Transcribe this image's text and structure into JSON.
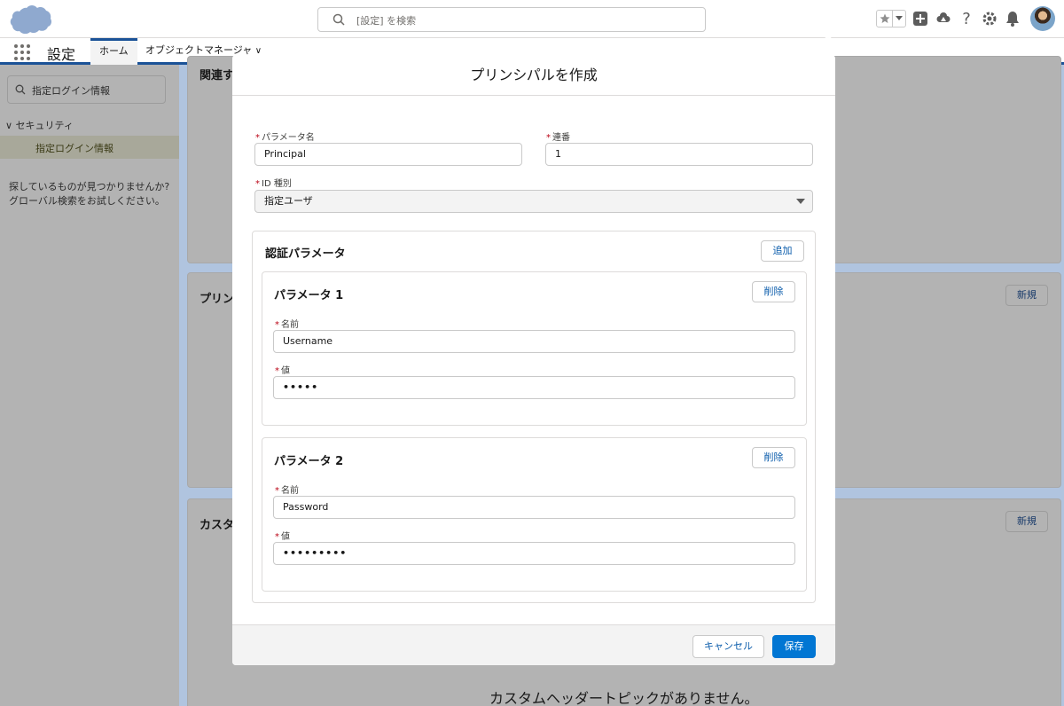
{
  "header": {
    "search_placeholder": "[設定] を検索"
  },
  "context_bar": {
    "app_name": "設定",
    "tabs": [
      {
        "label": "ホーム"
      },
      {
        "label": "オブジェクトマネージャ"
      }
    ]
  },
  "sidebar": {
    "search_value": "指定ログイン情報",
    "section": "セキュリティ",
    "selected_item": "指定ログイン情報",
    "hint": "探しているものが見つかりませんか? グローバル検索をお試しください。"
  },
  "background": {
    "card1_title": "関連す",
    "card2_title": "プリン",
    "card3_title": "カスタ",
    "new_button_label": "新規",
    "empty_message": "カスタムヘッダートピックがありません。"
  },
  "modal": {
    "title": "プリンシパルを作成",
    "param_name_label": "パラメータ名",
    "param_name_value": "Principal",
    "sequence_label": "連番",
    "sequence_value": "1",
    "id_type_label": "ID 種別",
    "id_type_value": "指定ユーザ",
    "auth_section_title": "認証パラメータ",
    "add_button": "追加",
    "parameters": [
      {
        "title": "パラメータ 1",
        "delete_label": "削除",
        "name_label": "名前",
        "name_value": "Username",
        "value_label": "値",
        "value_masked": "•••••"
      },
      {
        "title": "パラメータ 2",
        "delete_label": "削除",
        "name_label": "名前",
        "name_value": "Password",
        "value_label": "値",
        "value_masked": "•••••••••"
      }
    ],
    "cancel_button": "キャンセル",
    "save_button": "保存"
  },
  "colors": {
    "brand": "#0176d3",
    "link": "#0b5cab",
    "required": "#ba0517",
    "overlay": "#b0c4df"
  },
  "icons": {
    "logo": "cloud-logo",
    "close": "close-icon",
    "search": "search-icon"
  }
}
